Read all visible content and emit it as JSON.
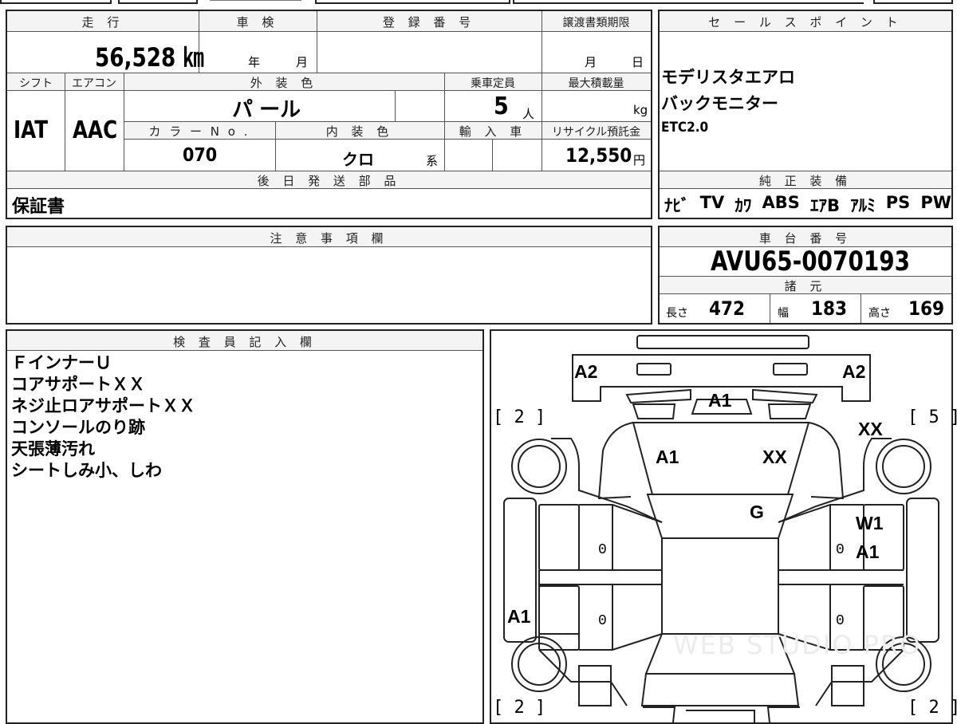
{
  "vehicle": {
    "mileage_header": "走 行",
    "mileage": "56,528 ㎞",
    "inspection_header": "車 検",
    "inspection_year_label": "年",
    "inspection_month_label": "月",
    "registration_header": "登 録 番 号",
    "transfer_deadline_header": "譲渡書類期限",
    "transfer_month_label": "月",
    "transfer_day_label": "日",
    "shift_header": "シフト",
    "shift": "IAT",
    "aircon_header": "エアコン",
    "aircon": "AAC",
    "exterior_color_header": "外 装 色",
    "exterior_color": "パ ール",
    "capacity_header": "乗車定員",
    "capacity": "5",
    "capacity_unit": "人",
    "max_load_header": "最大積載量",
    "max_load_unit": "kg",
    "color_no_header": "カ ラ ー N o .",
    "color_no": "070",
    "interior_color_header": "内 装 色",
    "interior_color": "クロ",
    "interior_suffix": "系",
    "import_header": "輸 入 車",
    "recycle_header": "リサイクル預託金",
    "recycle_fee": "12,550",
    "recycle_unit": "円",
    "later_items_header": "後 日 発 送 部 品",
    "later_items": "保証書",
    "notes_header": "注 意 事 項 欄"
  },
  "sales_points": {
    "header": "セ ー ル ス ポ イ ン ト",
    "items": [
      "モデリスタエアロ",
      "バックモニター",
      "ETC2.0"
    ]
  },
  "equipment": {
    "header": "純 正 装 備",
    "items": [
      "ﾅﾋﾞ",
      "TV",
      "ｶﾜ",
      "ABS",
      "ｴｱB",
      "ｱﾙﾐ",
      "PS",
      "PW"
    ]
  },
  "chassis": {
    "header": "車 台 番 号",
    "number": "AVU65-0070193"
  },
  "specs": {
    "header": "諸 元",
    "length_label": "長さ",
    "length": "472",
    "width_label": "幅",
    "width": "183",
    "height_label": "高さ",
    "height": "169"
  },
  "inspector": {
    "header": "検 査 員 記 入 欄",
    "lines": [
      "ＦインナーＵ",
      "コアサポートＸＸ",
      "ネジ止ロアサポートＸＸ",
      "コンソールのり跡",
      "天張薄汚れ",
      "シートしみ小、しわ"
    ]
  },
  "diagram": {
    "marks": {
      "front_left": "A2",
      "front_right": "A2",
      "front_center": "A1",
      "hood_left": "A1",
      "hood_right": "XX",
      "fender_right": "XX",
      "windshield": "G",
      "door_right_1": "W1",
      "door_right_2": "A1",
      "side_left": "A1"
    },
    "tires": {
      "front_left": "[ 2 ]",
      "front_right": "[ 5 ]",
      "rear_left": "[ 2 ]",
      "rear_right": "[ 2 ]"
    },
    "zeros": [
      "0",
      "0",
      "0",
      "0"
    ],
    "watermark": "WEB STUDIO PRO"
  }
}
